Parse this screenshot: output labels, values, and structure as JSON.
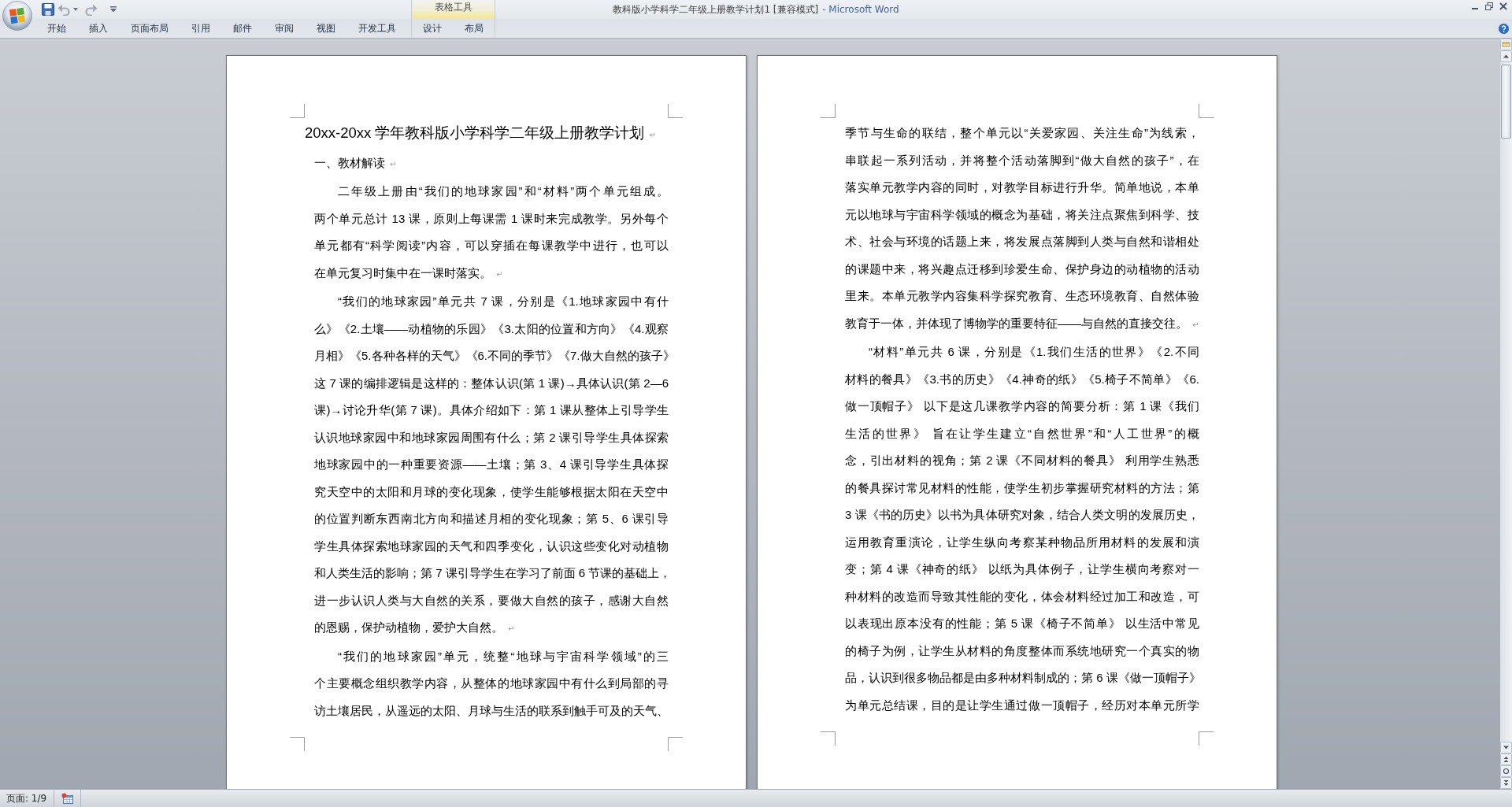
{
  "window": {
    "title": "教科版小学科学二年级上册教学计划1 [兼容模式]",
    "app_name": "- Microsoft Word"
  },
  "quick_access": [
    {
      "kind": "save",
      "disabled": false
    },
    {
      "kind": "undo",
      "disabled": true
    },
    {
      "kind": "redo",
      "disabled": true
    }
  ],
  "ribbon": {
    "tabs": [
      {
        "label": "开始",
        "selected": false
      },
      {
        "label": "插入",
        "selected": false
      },
      {
        "label": "页面布局",
        "selected": false
      },
      {
        "label": "引用",
        "selected": false
      },
      {
        "label": "邮件",
        "selected": false
      },
      {
        "label": "审阅",
        "selected": false
      },
      {
        "label": "视图",
        "selected": false
      },
      {
        "label": "开发工具",
        "selected": false
      }
    ],
    "contextual_group": {
      "label": "表格工具",
      "tabs": [
        {
          "label": "设计",
          "selected": false
        },
        {
          "label": "布局",
          "selected": false
        }
      ]
    }
  },
  "document": {
    "pages": [
      {
        "paragraphs": [
          {
            "kind": "title",
            "lines": [
              "20xx-20xx 学年教科版小学科学二年级上册教学计划"
            ],
            "end_mark": "↵"
          },
          {
            "kind": "heading",
            "lines": [
              "一、教材解读"
            ],
            "end_mark": "↵"
          },
          {
            "kind": "body",
            "lines": [
              "二年级上册由“我们的地球家园”和“材料”两个单元组成。",
              "两个单元总计 13 课，原则上每课需 1 课时来完成教学。另外每个",
              "单元都有“科学阅读”内容，可以穿插在每课教学中进行，也可以",
              "在单元复习时集中在一课时落实。"
            ],
            "end_mark": "↵"
          },
          {
            "kind": "body",
            "lines": [
              "“我们的地球家园”单元共 7 课，分别是《1.地球家园中有什",
              "么》《2.土壤——动植物的乐园》《3.太阳的位置和方向》《4.观察",
              "月相》《5.各种各样的天气》《6.不同的季节》《7.做大自然的孩子》",
              "这 7 课的编排逻辑是这样的：整体认识(第 1 课)→具体认识(第 2—6",
              "课)→讨论升华(第 7 课)。具体介绍如下：第 1 课从整体上引导学生",
              "认识地球家园中和地球家园周围有什么；第 2 课引导学生具体探索",
              "地球家园中的一种重要资源——土壤；第 3、4 课引导学生具体探",
              "究天空中的太阳和月球的变化现象，使学生能够根据太阳在天空中",
              "的位置判断东西南北方向和描述月相的变化现象；第 5、6 课引导",
              "学生具体探索地球家园的天气和四季变化，认识这些变化对动植物",
              "和人类生活的影响；第 7 课引导学生在学习了前面 6 节课的基础上，",
              "进一步认识人类与大自然的关系，要做大自然的孩子，感谢大自然",
              "的恩赐，保护动植物，爱护大自然。"
            ],
            "end_mark": "↵"
          },
          {
            "kind": "body",
            "lines": [
              "“我们的地球家园”单元，统整“地球与宇宙科学领域”的三",
              "个主要概念组织教学内容，从整体的地球家园中有什么到局部的寻",
              "访土壤居民，从遥远的太阳、月球与生活的联系到触手可及的天气、"
            ]
          }
        ]
      },
      {
        "paragraphs": [
          {
            "kind": "continuation",
            "lines": [
              "季节与生命的联结，整个单元以“关爱家园、关注生命”为线索，",
              "串联起一系列活动，并将整个活动落脚到“做大自然的孩子”，在",
              "落实单元教学内容的同时，对教学目标进行升华。简单地说，本单",
              "元以地球与宇宙科学领域的概念为基础，将关注点聚焦到科学、技",
              "术、社会与环境的话题上来，将发展点落脚到人类与自然和谐相处",
              "的课题中来，将兴趣点迁移到珍爱生命、保护身边的动植物的活动",
              "里来。本单元教学内容集科学探究教育、生态环境教育、自然体验",
              "教育于一体，并体现了博物学的重要特征——与自然的直接交往。"
            ],
            "end_mark": "↵"
          },
          {
            "kind": "body",
            "lines": [
              "“材料”单元共 6 课，分别是《1.我们生活的世界》《2.不同",
              "材料的餐具》《3.书的历史》《4.神奇的纸》《5.椅子不简单》《6.",
              "做一顶帽子》 以下是这几课教学内容的简要分析：第 1 课《我们",
              "生活的世界》 旨在让学生建立“自然世界”和“人工世界”的概",
              "念，引出材料的视角；第 2 课《不同材料的餐具》 利用学生熟悉",
              "的餐具探讨常见材料的性能，使学生初步掌握研究材料的方法；第",
              "3 课《书的历史》以书为具体研究对象，结合人类文明的发展历史，",
              "运用教育重演论，让学生纵向考察某种物品所用材料的发展和演",
              "变；第 4 课《神奇的纸》 以纸为具体例子，让学生横向考察对一",
              "种材料的改造而导致其性能的变化，体会材料经过加工和改造，可",
              "以表现出原本没有的性能；第 5 课《椅子不简单》 以生活中常见",
              "的椅子为例，让学生从材料的角度整体而系统地研究一个真实的物",
              "品，认识到很多物品都是由多种材料制成的；第 6 课《做一顶帽子》",
              "为单元总结课，目的是让学生通过做一顶帽子，经历对本单元所学"
            ]
          }
        ]
      }
    ]
  },
  "status_bar": {
    "page_indicator": "页面: 1/9"
  }
}
